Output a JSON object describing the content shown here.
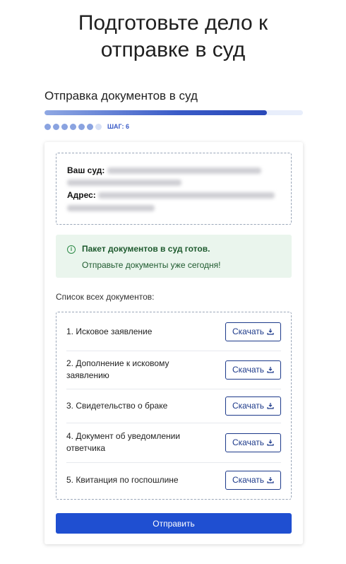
{
  "page": {
    "title_line1": "Подготовьте дело к",
    "title_line2": "отправке в суд"
  },
  "section": {
    "title": "Отправка документов в суд",
    "progress_percent": 86,
    "steps_total": 7,
    "steps_done": 6,
    "step_label": "ШАГ: 6"
  },
  "court": {
    "court_label": "Ваш суд:",
    "address_label": "Адрес:"
  },
  "alert": {
    "title": "Пакет документов в суд готов.",
    "text": "Отправьте документы уже сегодня!"
  },
  "documents": {
    "title": "Список всех документов:",
    "download_label": "Скачать",
    "items": [
      {
        "name": "1. Исковое заявление"
      },
      {
        "name": "2. Дополнение к исковому заявлению"
      },
      {
        "name": "3. Свидетельство о браке"
      },
      {
        "name": "4. Документ об уведомлении ответчика"
      },
      {
        "name": "5. Квитанция по госпошлине"
      }
    ]
  },
  "submit": {
    "label": "Отправить"
  },
  "colors": {
    "accent": "#1f4fd1",
    "outline": "#1d3a8a",
    "success_bg": "#eaf5ed",
    "success_text": "#1e5a2e"
  }
}
